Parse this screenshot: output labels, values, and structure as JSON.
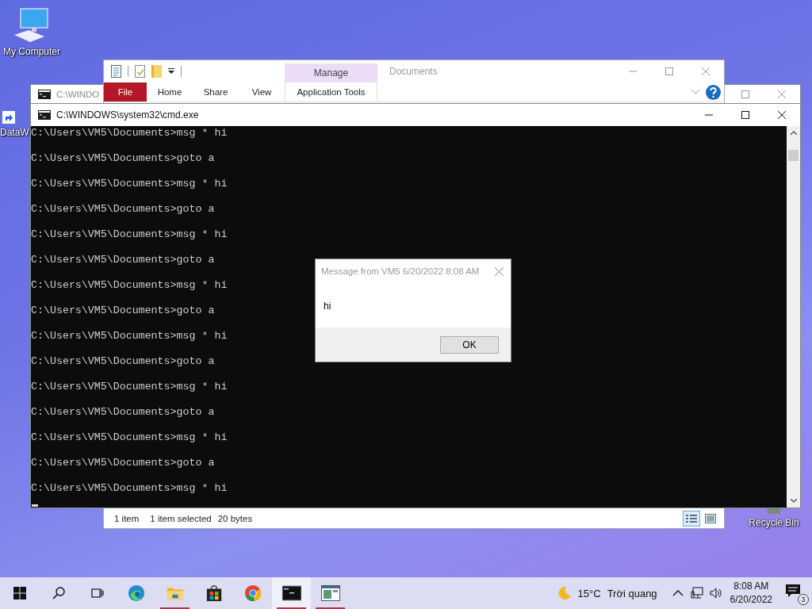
{
  "desktop_icons": [
    {
      "label": "My Computer",
      "kind": "computer"
    },
    {
      "label": "DataW",
      "kind": "shortcut"
    },
    {
      "label": "Recycle Bin",
      "kind": "bin"
    }
  ],
  "explorer": {
    "title": "Documents",
    "contextual_header": "Manage",
    "ribbon_tabs": [
      {
        "label": "File",
        "kind": "file"
      },
      {
        "label": "Home",
        "kind": "tab"
      },
      {
        "label": "Share",
        "kind": "tab"
      },
      {
        "label": "View",
        "kind": "tab"
      },
      {
        "label": "Application Tools",
        "kind": "contextual"
      }
    ],
    "status_bar": {
      "item_count": "1 item",
      "selection": "1 item selected",
      "size": "20 bytes"
    },
    "view_buttons": [
      {
        "kind": "details",
        "selected": true
      },
      {
        "kind": "thumbnails",
        "selected": false
      }
    ]
  },
  "back_console": {
    "title": "C:\\WINDO"
  },
  "console": {
    "title": "C:\\WINDOWS\\system32\\cmd.exe",
    "lines": [
      "C:\\Users\\VM5\\Documents>msg * hi",
      "C:\\Users\\VM5\\Documents>goto a",
      "C:\\Users\\VM5\\Documents>msg * hi",
      "C:\\Users\\VM5\\Documents>goto a",
      "C:\\Users\\VM5\\Documents>msg * hi",
      "C:\\Users\\VM5\\Documents>goto a",
      "C:\\Users\\VM5\\Documents>msg * hi",
      "C:\\Users\\VM5\\Documents>goto a",
      "C:\\Users\\VM5\\Documents>msg * hi",
      "C:\\Users\\VM5\\Documents>goto a",
      "C:\\Users\\VM5\\Documents>msg * hi",
      "C:\\Users\\VM5\\Documents>goto a",
      "C:\\Users\\VM5\\Documents>msg * hi",
      "C:\\Users\\VM5\\Documents>goto a",
      "C:\\Users\\VM5\\Documents>msg * hi"
    ]
  },
  "dialog": {
    "title": "Message from VM5 6/20/2022 8:08 AM",
    "message": "hi",
    "button": "OK"
  },
  "taskbar": {
    "apps": [
      {
        "kind": "start",
        "running": false,
        "active": false
      },
      {
        "kind": "search",
        "running": false,
        "active": false
      },
      {
        "kind": "taskview",
        "running": false,
        "active": false
      },
      {
        "kind": "edge",
        "running": false,
        "active": false
      },
      {
        "kind": "explorer",
        "running": true,
        "active": false
      },
      {
        "kind": "store",
        "running": false,
        "active": false
      },
      {
        "kind": "chrome",
        "running": false,
        "active": false
      },
      {
        "kind": "terminal",
        "running": true,
        "active": true
      },
      {
        "kind": "window",
        "running": true,
        "active": false
      }
    ],
    "weather": {
      "temperature": "15°C",
      "condition": "Trời quang"
    },
    "time": "8:08 AM",
    "date": "6/20/2022",
    "notification_count": "3"
  }
}
